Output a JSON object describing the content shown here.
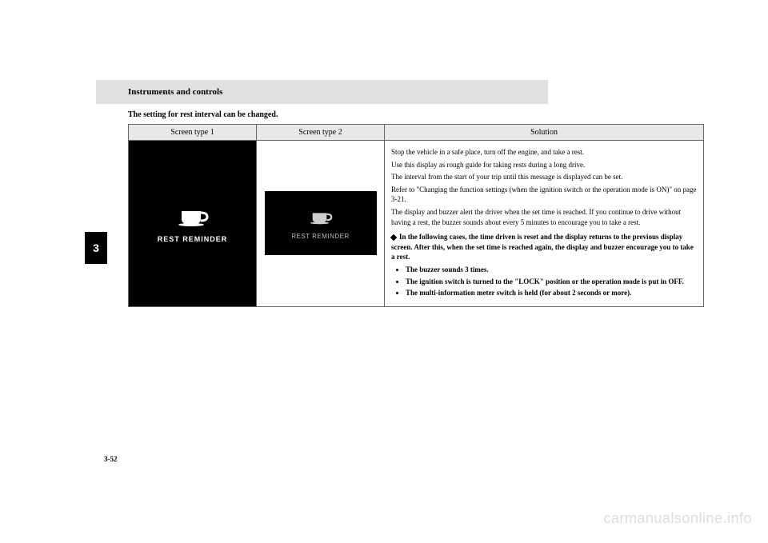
{
  "header": {
    "section_title": "Instruments and controls",
    "sub_header": "The setting for rest interval can be changed."
  },
  "side_tab": "3",
  "table": {
    "headers": {
      "col1": "Screen type 1",
      "col2": "Screen type 2",
      "col3": "Solution"
    },
    "row": {
      "screen1_label": "REST REMINDER",
      "screen2_label": "REST REMINDER",
      "solution": {
        "p1": "Stop the vehicle in a safe place, turn off the engine, and take a rest.",
        "p2": "Use this display as rough guide for taking rests during a long drive.",
        "p3": "The interval from the start of your trip until this message is displayed can be set.",
        "p4": "Refer to \"Changing the function settings (when the ignition switch or the operation mode is ON)\" on page 3-21.",
        "p5": "The display and buzzer alert the driver when the set time is reached. If you continue to drive without having a rest, the buzzer sounds about every 5 minutes to encourage you to take a rest.",
        "note_lead": "In the following cases, the time driven is reset and the display returns to the previous display screen. After this, when the set time is reached again, the display and buzzer encourage you to take a rest.",
        "bullets": {
          "b1": "The buzzer sounds 3 times.",
          "b2": "The ignition switch is turned to the \"LOCK\" position or the operation mode is put in OFF.",
          "b3": "The multi-information meter switch is held (for about 2 seconds or more)."
        }
      }
    }
  },
  "page_number": "3-52",
  "watermark": "carmanualsonline.info"
}
